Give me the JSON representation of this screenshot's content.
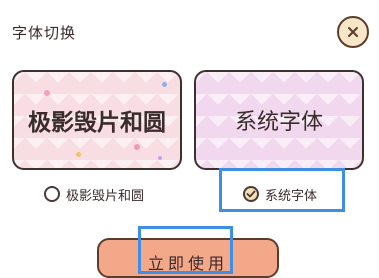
{
  "dialog": {
    "title": "字体切换",
    "close_icon": "close-icon"
  },
  "fonts": [
    {
      "card_label": "极影毁片和圆",
      "option_label": "极影毁片和圆",
      "selected": false
    },
    {
      "card_label": "系统字体",
      "option_label": "系统字体",
      "selected": true
    }
  ],
  "action": {
    "use_label": "立即使用"
  },
  "colors": {
    "accent_button": "#f4a88a",
    "highlight_box": "#3d8fe6",
    "card_left_bg": "#f8dde2",
    "card_right_bg": "#f2d8ee"
  }
}
